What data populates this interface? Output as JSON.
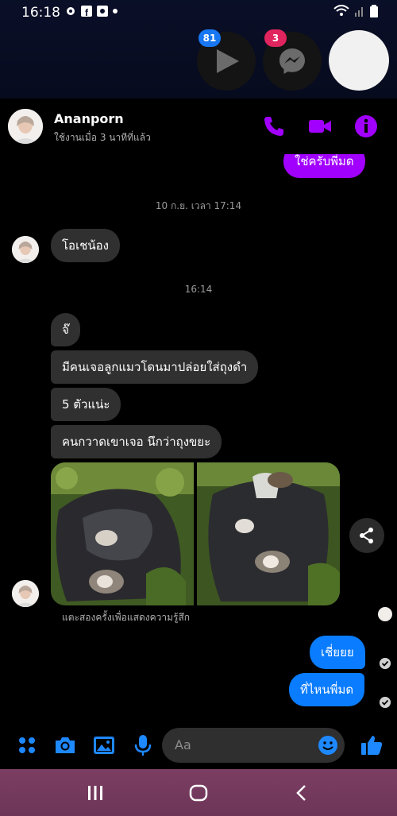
{
  "status_bar": {
    "time": "16:18"
  },
  "chat_heads": {
    "video_badge": "81",
    "messenger_badge": "3"
  },
  "header": {
    "contact_name": "Ananporn",
    "active_status": "ใช้งานเมื่อ 3 นาทีที่แล้ว"
  },
  "messages": {
    "prev_outgoing": "ใช่ครับพี่มด",
    "timestamp_1": "10 ก.ย. เวลา 17:14",
    "incoming_1": "โอเชน้อง",
    "timestamp_2": "16:14",
    "incoming_2": "จ๊",
    "incoming_3": "มีคนเจอลูกแมวโดนมาปล่อยใส่ถุงดำ",
    "incoming_4": "5 ตัวแน่ะ",
    "incoming_5": "คนกวาดเขาเจอ นึกว่าถุงขยะ",
    "reaction_hint": "แตะสองครั้งเพื่อแสดงความรู้สึก",
    "outgoing_1": "เชี่ยยย",
    "outgoing_2": "ที่ไหนพี่มด"
  },
  "composer": {
    "placeholder": "Aa"
  },
  "colors": {
    "accent_purple": "#a100ff",
    "outgoing_blue": "#0a7cff",
    "incoming_gray": "#303030",
    "icon_blue": "#1e88ff"
  }
}
